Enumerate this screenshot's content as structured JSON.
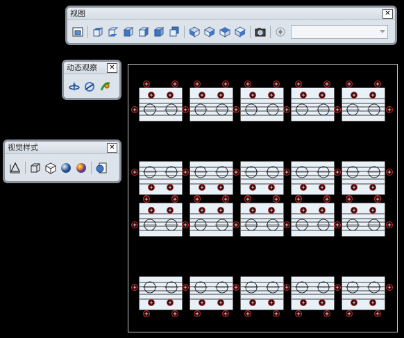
{
  "toolbars": {
    "view": {
      "title": "视图",
      "close": "✕",
      "combo_value": "",
      "buttons": [
        "named-views-icon",
        "top-view-icon",
        "bottom-view-icon",
        "left-view-icon",
        "right-view-icon",
        "front-view-icon",
        "back-view-icon",
        "sw-iso-icon",
        "se-iso-icon",
        "ne-iso-icon",
        "nw-iso-icon",
        "camera-icon",
        "view-combo-icon"
      ]
    },
    "orbit": {
      "title": "动态观察",
      "close": "✕",
      "buttons": [
        "constrained-orbit-icon",
        "free-orbit-icon",
        "continuous-orbit-icon"
      ]
    },
    "visual_styles": {
      "title": "视觉样式",
      "close": "✕",
      "buttons": [
        "2d-wireframe-icon",
        "3d-wireframe-icon",
        "hidden-icon",
        "realistic-icon",
        "conceptual-icon",
        "visual-style-manager-icon"
      ]
    }
  },
  "drawing": {
    "groups": [
      {
        "row": 0,
        "cols": 5,
        "orientation": "down"
      },
      {
        "row": 1,
        "cols": 5,
        "orientation": "up"
      },
      {
        "row": 2,
        "cols": 5,
        "orientation": "down"
      },
      {
        "row": 3,
        "cols": 5,
        "orientation": "up"
      }
    ],
    "colors": {
      "part_fill": "#e8f0f8",
      "part_line": "#000000",
      "marker_ring": "#c03030",
      "marker_fill": "#2a0000"
    }
  }
}
